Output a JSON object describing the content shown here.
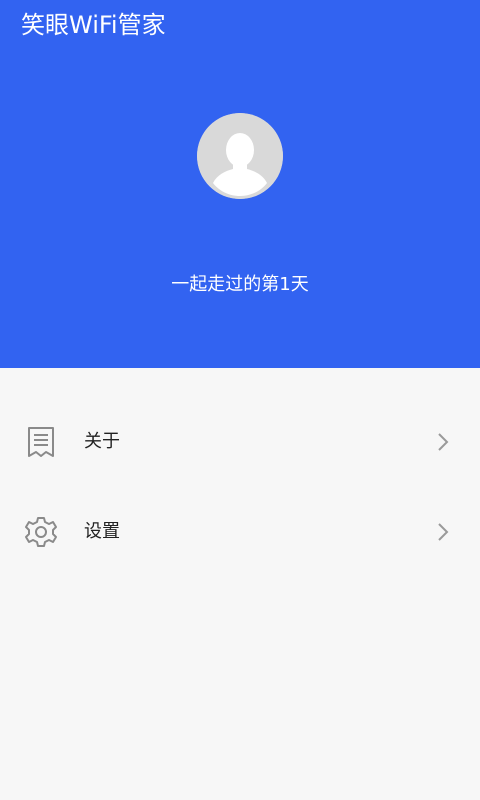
{
  "app": {
    "title": "笑眼WiFi管家"
  },
  "profile": {
    "days_text": "一起走过的第1天"
  },
  "menu": {
    "items": [
      {
        "label": "关于",
        "icon": "document-icon"
      },
      {
        "label": "设置",
        "icon": "gear-icon"
      }
    ]
  },
  "colors": {
    "header_bg": "#3263f1",
    "page_bg": "#f7f7f7",
    "avatar_bg": "#d9d9d9",
    "icon_gray": "#8a8a8a"
  }
}
